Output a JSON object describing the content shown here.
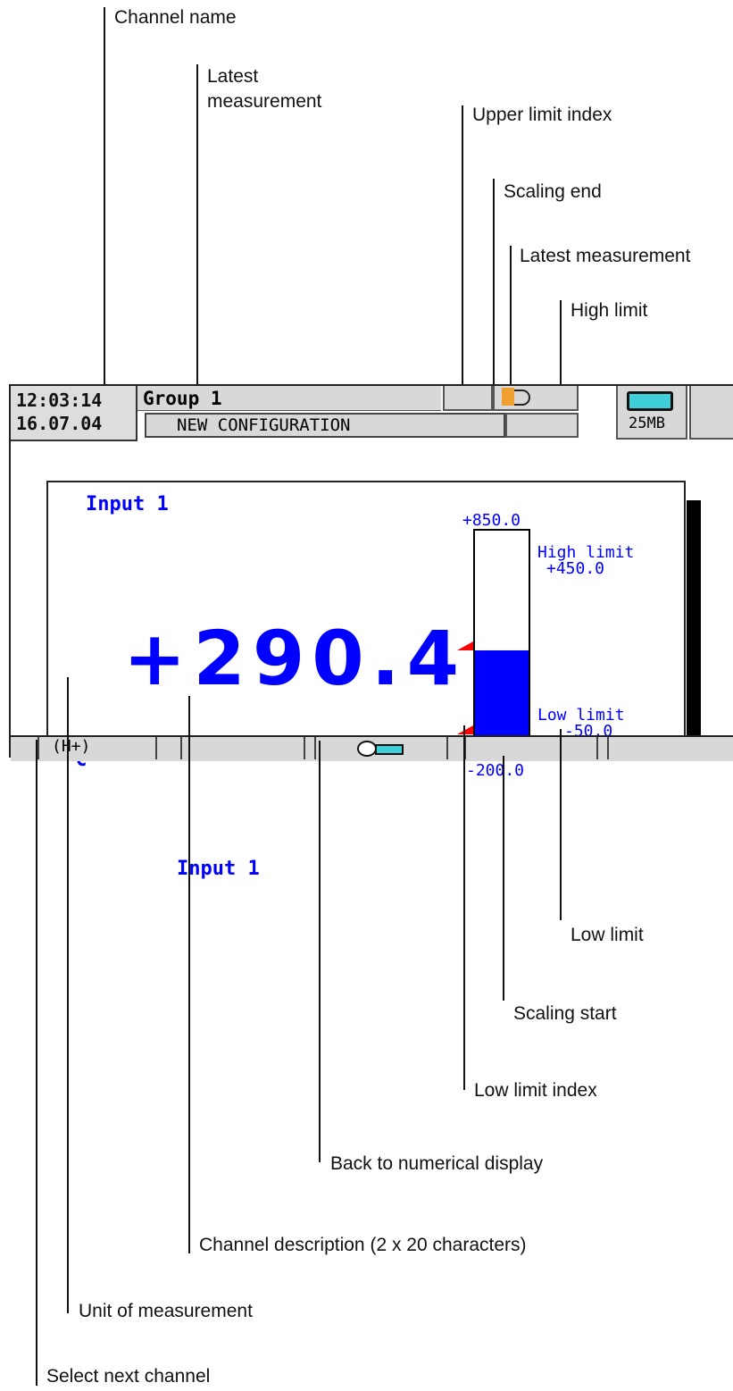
{
  "callouts": {
    "channel_name": "Channel name",
    "latest_measurement_1": "Latest",
    "latest_measurement_2": "measurement",
    "upper_limit_index": "Upper limit index",
    "scaling_end": "Scaling end",
    "latest_measurement_bar": "Latest measurement",
    "high_limit": "High limit",
    "low_limit": "Low limit",
    "scaling_start": "Scaling start",
    "low_limit_index": "Low limit index",
    "back_numerical": "Back to numerical display",
    "channel_description": "Channel description (2 x 20 characters)",
    "unit": "Unit of measurement",
    "select_next": "Select next channel"
  },
  "header": {
    "time": "12:03:14",
    "date": "16.07.04",
    "group": "Group 1",
    "status": "NEW CONFIGURATION",
    "memory": "25MB"
  },
  "panel": {
    "channel_name": "Input 1",
    "value": "+290.4",
    "unit": "°C",
    "description": "Input 1",
    "scale_end": "+850.0",
    "scale_start": "-200.0",
    "high_label": "High limit",
    "high_value": "+450.0",
    "low_label": "Low limit",
    "low_value": "-50.0",
    "bar_fill_fraction": 0.47
  },
  "footer": {
    "next_channel": "(H+)"
  },
  "colors": {
    "value": "#0000ff",
    "limit_marker": "#ff0000",
    "battery": "#3fcfd9",
    "indicator": "#f0a030"
  }
}
